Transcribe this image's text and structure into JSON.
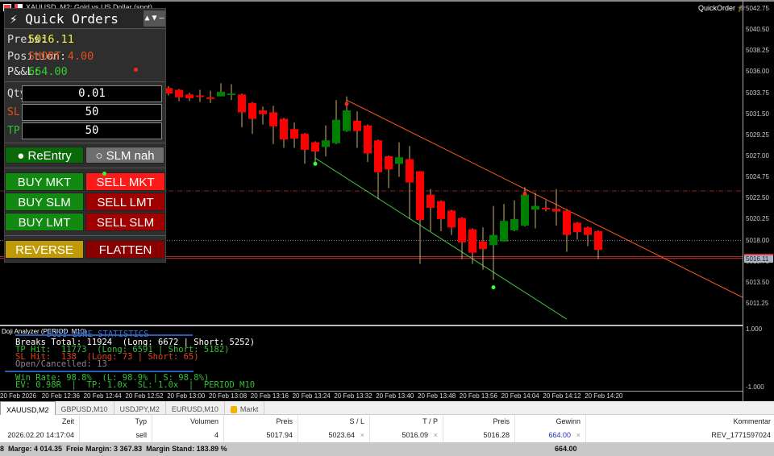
{
  "window": {
    "title": "XAUUSD, M2:  Gold vs US Dollar (spot)",
    "ea_label": "QuickOrder"
  },
  "colors": {
    "bull": "#008000",
    "bear": "#ff0000",
    "panel_bg": "#2e2e2e",
    "buy": "#128a12",
    "sell": "#a00000",
    "sell_active": "#ff1a1a",
    "reverse": "#c8a000",
    "flatten": "#8a0000"
  },
  "panel": {
    "title": "Quick Orders",
    "controls": [
      "▲",
      "▼",
      "–"
    ],
    "price_label": "Preis:",
    "price_value": "5016.11",
    "position_label": "Position:",
    "position_value": "SHORT 4.00",
    "pnl_label": "P&&L:",
    "pnl_value": "664.00",
    "qty_label": "Qty",
    "qty_value": "0.01",
    "sl_label": "SL",
    "sl_value": "50",
    "tp_label": "TP",
    "tp_value": "50",
    "reentry": "● ReEntry",
    "slm": "○ SLM nah",
    "buy_mkt": "BUY MKT",
    "sell_mkt": "SELL MKT",
    "buy_slm": "BUY SLM",
    "sell_lmt": "SELL LMT",
    "buy_lmt": "BUY LMT",
    "sell_slm": "SELL SLM",
    "reverse": "REVERSE",
    "flatten": "FLATTEN"
  },
  "price_axis": {
    "labels": [
      "5042.75",
      "5040.50",
      "5038.25",
      "5036.00",
      "5033.75",
      "5031.50",
      "5029.25",
      "5027.00",
      "5024.75",
      "5022.50",
      "5020.25",
      "5018.00",
      "5015.75",
      "5013.50",
      "5011.25"
    ],
    "current": "5016.11",
    "top": 5042.75,
    "bottom": 5011.25
  },
  "sub_axis": {
    "top": "1.000",
    "bottom": "-1.000"
  },
  "time_axis": [
    "20 Feb 2026",
    "20 Feb 12:36",
    "20 Feb 12:44",
    "20 Feb 12:52",
    "20 Feb 13:00",
    "20 Feb 13:08",
    "20 Feb 13:16",
    "20 Feb 13:24",
    "20 Feb 13:32",
    "20 Feb 13:40",
    "20 Feb 13:48",
    "20 Feb 13:56",
    "20 Feb 14:04",
    "20 Feb 14:12",
    "20 Feb 14:20"
  ],
  "chart_data": {
    "type": "candlestick",
    "timeframe": "M2",
    "ohlc": [
      [
        5034.3,
        5034.5,
        5033.5,
        5033.7
      ],
      [
        5034.1,
        5034.2,
        5032.9,
        5033.3
      ],
      [
        5033.6,
        5033.8,
        5032.9,
        5033.2
      ],
      [
        5033.5,
        5034.1,
        5032.8,
        5033.4
      ],
      [
        5033.3,
        5034.0,
        5032.7,
        5033.2
      ],
      [
        5033.4,
        5034.8,
        5033.4,
        5033.9
      ],
      [
        5033.7,
        5034.7,
        5033.0,
        5033.7
      ],
      [
        5033.6,
        5033.7,
        5030.1,
        5031.7
      ],
      [
        5032.7,
        5032.8,
        5029.4,
        5031.0
      ],
      [
        5031.9,
        5032.3,
        5030.4,
        5031.5
      ],
      [
        5031.7,
        5032.4,
        5028.3,
        5030.2
      ],
      [
        5031.0,
        5031.1,
        5027.9,
        5028.8
      ],
      [
        5029.9,
        5030.6,
        5027.9,
        5028.9
      ],
      [
        5029.4,
        5029.5,
        5026.2,
        5027.7
      ],
      [
        5028.5,
        5028.6,
        5026.0,
        5027.5
      ],
      [
        5028.0,
        5030.3,
        5027.0,
        5028.7
      ],
      [
        5028.4,
        5033.0,
        5028.3,
        5030.9
      ],
      [
        5029.7,
        5033.4,
        5029.6,
        5031.9
      ],
      [
        5030.8,
        5031.8,
        5027.9,
        5029.7
      ],
      [
        5030.3,
        5030.4,
        5026.4,
        5027.3
      ],
      [
        5028.7,
        5028.8,
        5022.4,
        5025.3
      ],
      [
        5027.0,
        5027.1,
        5023.6,
        5025.6
      ],
      [
        5026.2,
        5028.5,
        5024.8,
        5026.9
      ],
      [
        5026.7,
        5028.1,
        5020.3,
        5024.2
      ],
      [
        5025.4,
        5025.4,
        5015.5,
        5020.2
      ],
      [
        5022.9,
        5023.5,
        5019.0,
        5021.5
      ],
      [
        5022.2,
        5022.3,
        5019.0,
        5020.3
      ],
      [
        5021.2,
        5021.3,
        5018.6,
        5019.4
      ],
      [
        5020.4,
        5020.5,
        5016.0,
        5017.8
      ],
      [
        5019.2,
        5019.3,
        5015.5,
        5016.7
      ],
      [
        5017.9,
        5019.4,
        5014.9,
        5017.1
      ],
      [
        5017.5,
        5021.7,
        5013.8,
        5018.6
      ],
      [
        5017.9,
        5021.9,
        5017.9,
        5020.1
      ],
      [
        5019.1,
        5022.3,
        5019.0,
        5020.3
      ],
      [
        5019.6,
        5023.7,
        5019.5,
        5022.9
      ],
      [
        5021.3,
        5023.1,
        5019.3,
        5021.7
      ],
      [
        5021.5,
        5022.3,
        5021.1,
        5021.4
      ],
      [
        5021.4,
        5023.5,
        5019.6,
        5021.1
      ],
      [
        5021.2,
        5021.3,
        5016.8,
        5018.6
      ],
      [
        5019.9,
        5020.0,
        5018.1,
        5018.9
      ],
      [
        5019.4,
        5019.5,
        5017.4,
        5018.6
      ],
      [
        5019.0,
        5019.1,
        5016.0,
        5017.0
      ]
    ],
    "hlines": [
      {
        "price": 5023.3,
        "style": "dashdot",
        "color": "#8b2020"
      },
      {
        "price": 5018.0,
        "style": "dotted",
        "color": "#888"
      },
      {
        "price": 5016.3,
        "style": "solid",
        "color": "#c03030"
      },
      {
        "price": 5016.1,
        "style": "solid",
        "color": "#c03030"
      }
    ],
    "trendlines": [
      {
        "from": [
          17,
          5033.0
        ],
        "to": [
          55,
          5011.8
        ],
        "color": "#ff5a1e"
      },
      {
        "from": [
          14,
          5026.8
        ],
        "to": [
          38,
          5009.6
        ],
        "color": "#40c040"
      }
    ],
    "markers": [
      {
        "i": 14,
        "price": 5026.2,
        "color": "#33ff33"
      },
      {
        "i": 31,
        "price": 5013.0,
        "color": "#33ff33"
      },
      {
        "i": 17,
        "price": 5032.6,
        "color": "#ff2020"
      },
      {
        "i": 34,
        "price": 5023.0,
        "color": "#ff2020"
      }
    ]
  },
  "subwindow": {
    "label": "Doji Analyzer (PERIOD_M10)",
    "heading": "DOJI ZONE STATISTICS",
    "breaks": "Breaks Total: 11924  (Long: 6672 | Short: 5252)",
    "tp": "TP Hit:  11773  (Long: 6591 | Short: 5182)",
    "sl": "SL Hit:  138  (Long: 73 | Short: 65)",
    "open": "Open/Cancelled: 13",
    "winrate": "Win Rate: 98.8%  (L: 98.9% | S: 98.8%)",
    "ev": "EV: 0.98R  |  TP: 1.0x  SL: 1.0x  |  PERIOD_M10"
  },
  "tabs": [
    "XAUUSD,M2",
    "GBPUSD,M10",
    "USDJPY,M2",
    "EURUSD,M10",
    "Markt"
  ],
  "table": {
    "headers": [
      "Zeit",
      "Typ",
      "Volumen",
      "Preis",
      "S / L",
      "T / P",
      "Preis",
      "Gewinn",
      "Kommentar"
    ],
    "row": [
      "2026.02.20 14:17:04",
      "sell",
      "4",
      "5017.94",
      "5023.64",
      "5016.09",
      "5016.28",
      "664.00",
      "REV_1771597024"
    ],
    "close_mark": "×"
  },
  "footer": {
    "summary": "8  Marge: 4 014.35  Freie Margin: 3 367.83  Margin Stand: 183.89 %",
    "total": "664.00"
  }
}
